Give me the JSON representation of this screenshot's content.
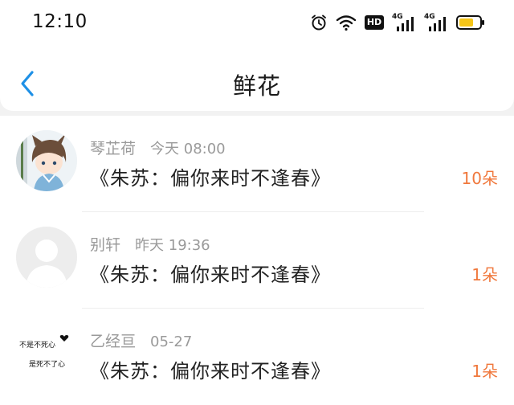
{
  "status_bar": {
    "time": "12:10",
    "icons": [
      "alarm-icon",
      "wifi-icon",
      "hd-icon",
      "signal-4g-icon",
      "signal-4g-icon",
      "battery-icon"
    ],
    "hd_label": "HD",
    "network_label_1": "4G",
    "network_label_2": "4G",
    "battery_color": "#f5c518"
  },
  "header": {
    "title": "鲜花",
    "back_icon": "chevron-left-icon",
    "accent": "#1e90e6"
  },
  "records": [
    {
      "name": "琴芷荷",
      "date": "今天 08:00",
      "novel": "《朱苏：偏你来时不逢春》",
      "count": "10朵",
      "avatar": "anime-avatar"
    },
    {
      "name": "别轩",
      "date": "昨天 19:36",
      "novel": "《朱苏：偏你来时不逢春》",
      "count": "1朵",
      "avatar": "default-avatar"
    },
    {
      "name": "乙经亘",
      "date": "05-27",
      "novel": "《朱苏：偏你来时不逢春》",
      "count": "1朵",
      "avatar": "text-avatar",
      "avatar_text_line1": "不是不死心",
      "avatar_text_line2": "是死不了心"
    }
  ],
  "colors": {
    "count": "#f0783c",
    "meta": "#9a9a9a"
  }
}
